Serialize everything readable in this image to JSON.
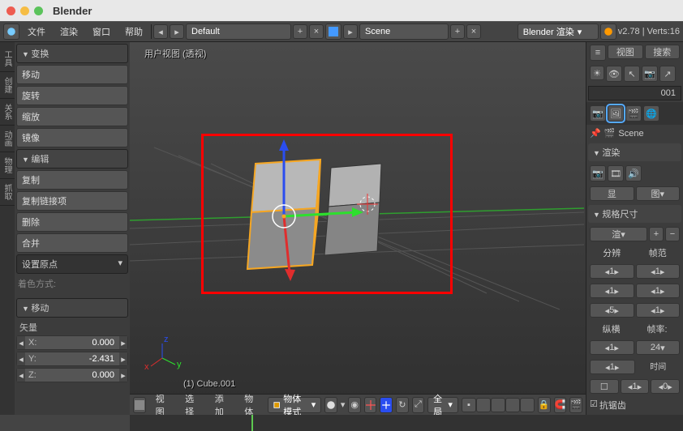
{
  "app_title": "Blender",
  "top_menu": {
    "file": "文件",
    "render": "渲染",
    "window": "窗口",
    "help": "帮助"
  },
  "layout_dd": "Default",
  "scene_dd": "Scene",
  "render_engine": "Blender 渲染",
  "version_info": "v2.78 | Verts:16",
  "viewport_header": "用户视图 (透视)",
  "active_object": "(1) Cube.001",
  "left_tabs": [
    "工具",
    "创建",
    "关系",
    "动画",
    "物理",
    "抓取"
  ],
  "tools": {
    "transform_heading": "变换",
    "move_label": "移动",
    "rotate_label": "旋转",
    "scale_label": "缩放",
    "mirror_label": "镜像",
    "edit_heading": "编辑",
    "duplicate_label": "复制",
    "dup_linked_label": "复制链接项",
    "delete_label": "删除",
    "join_label": "合并",
    "set_origin_label": "设置原点",
    "shading_label": "着色方式:"
  },
  "operator_panel": {
    "heading": "移动",
    "vector_label": "矢量",
    "x_label": "X:",
    "x_value": "0.000",
    "y_label": "Y:",
    "y_value": "-2.431",
    "z_label": "Z:",
    "z_value": "0.000"
  },
  "vp_header_menu": {
    "view": "视图",
    "select": "选择",
    "add": "添加",
    "object": "物体",
    "mode": "物体模式",
    "orientation": "全局"
  },
  "right_panel": {
    "view_btn": "视图",
    "search_btn": "搜索",
    "count_badge": "001",
    "outliner_root": "Scene",
    "render_heading": "渲染",
    "display_label": "显",
    "image_label": "图",
    "dims_heading": "规格尺寸",
    "render_preset": "渲",
    "resolution_label": "分辨",
    "frame_range_label": "帧范",
    "res_x": "1",
    "res_y": "1",
    "res_pct": "5",
    "aspect_label": "纵横",
    "rate_label": "帧率:",
    "aspect_x": "1",
    "fps": "24",
    "time_label": "时间",
    "tm_l": "1",
    "tm_r": "0",
    "aa_label": "抗锯齿"
  }
}
